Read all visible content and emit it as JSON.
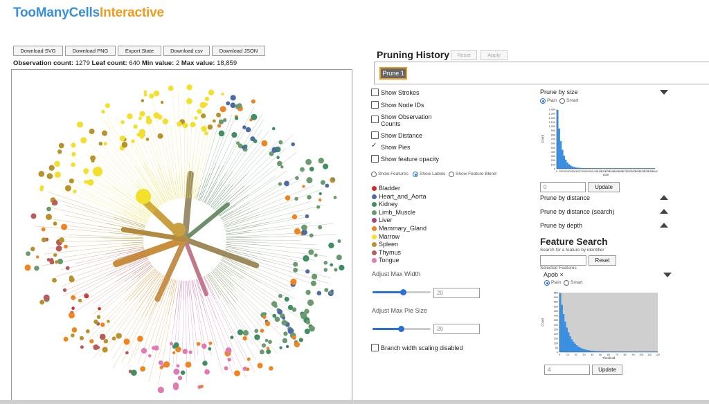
{
  "app": {
    "title_part1": "TooManyCells",
    "title_part2": "Interactive"
  },
  "toolbar": {
    "download_svg": "Download SVG",
    "download_png": "Download PNG",
    "export_state": "Export State",
    "download_csv": "Download csv",
    "download_json": "Download JSON"
  },
  "stats": {
    "obs_label": "Observation count:",
    "obs_value": "1279",
    "leaf_label": "Leaf count:",
    "leaf_value": "640",
    "min_label": "Min value:",
    "min_value": "2",
    "max_label": "Max value:",
    "max_value": "18,859"
  },
  "pruning_history": {
    "title": "Pruning History",
    "reset_label": "Reset",
    "apply_label": "Apply",
    "items": [
      "Prune 1"
    ]
  },
  "options": {
    "show_strokes": "Show Strokes",
    "show_node_ids": "Show Node IDs",
    "show_obs_counts_1": "Show Observation",
    "show_obs_counts_2": "Counts",
    "show_distance": "Show Distance",
    "show_pies": "Show Pies",
    "show_feature_opacity": "Show feature opacity",
    "show_pies_checked": true
  },
  "view_mode": {
    "features": "Show Features",
    "labels": "Show Labels",
    "blend": "Show Feature Blend",
    "selected": "Show Labels"
  },
  "legend": [
    {
      "label": "Bladder",
      "color": "#d42a2a"
    },
    {
      "label": "Heart_and_Aorta",
      "color": "#4e6aa6"
    },
    {
      "label": "Kidney",
      "color": "#3f8f62"
    },
    {
      "label": "Limb_Muscle",
      "color": "#6a9a6e"
    },
    {
      "label": "Liver",
      "color": "#a04a7c"
    },
    {
      "label": "Mammary_Gland",
      "color": "#f0841e"
    },
    {
      "label": "Marrow",
      "color": "#f2e02c"
    },
    {
      "label": "Spleen",
      "color": "#b8922a"
    },
    {
      "label": "Thymus",
      "color": "#b85b5b"
    },
    {
      "label": "Tongue",
      "color": "#e07ab0"
    }
  ],
  "sliders": {
    "max_width_label": "Adjust Max Width",
    "max_width_value": "20",
    "max_pie_label": "Adjust Max Pie Size",
    "max_pie_value": "20",
    "branch_width_label": "Branch width scaling disabled"
  },
  "prune": {
    "by_size": "Prune by size",
    "plain": "Plain",
    "smart": "Smart",
    "size_value": "0",
    "update": "Update",
    "by_distance": "Prune by distance",
    "by_distance_search": "Prune by distance (search)",
    "by_depth": "Prune by depth"
  },
  "size_hist": {
    "ylabel": "Count",
    "xlabel": "Size",
    "yticks": [
      "1,400",
      "1,300",
      "1,200",
      "1,100",
      "1,000",
      "900",
      "800",
      "700",
      "600",
      "500",
      "400",
      "300",
      "200",
      "100",
      "0"
    ],
    "xticks": [
      "0",
      "200",
      "300",
      "400",
      "500",
      "600",
      "700",
      "800",
      "900",
      "1,000",
      "1,100",
      "1,200",
      "1,300",
      "1,400",
      "1,500",
      "1,600",
      "1,700",
      "1,800",
      "1,900",
      "2,000",
      "2,100",
      "2,200",
      "2,300",
      "2,400"
    ]
  },
  "feature_search": {
    "title": "Feature Search",
    "subtitle": "Search for a feature by identifier",
    "reset": "Reset",
    "selected_label": "Selected Features",
    "selected_feature": "Apob",
    "remove_glyph": "×",
    "plain": "Plain",
    "smart": "Smart",
    "threshold_value": "4",
    "update": "Update"
  },
  "thresh_hist": {
    "ylabel": "Count",
    "xlabel": "Theshold",
    "yticks": [
      "650",
      "600",
      "550",
      "500",
      "450",
      "400",
      "350",
      "300",
      "250",
      "200",
      "150",
      "100",
      "50",
      "0"
    ],
    "xticks": [
      "0",
      "10",
      "20",
      "30",
      "40",
      "50",
      "60",
      "70",
      "80",
      "90",
      "100",
      "110",
      "120"
    ]
  },
  "colors": {
    "accent_blue": "#2a6fd8",
    "title_blue": "#3a8fd9",
    "title_orange": "#f29a1e",
    "hist_blue": "#3a8fe0"
  }
}
